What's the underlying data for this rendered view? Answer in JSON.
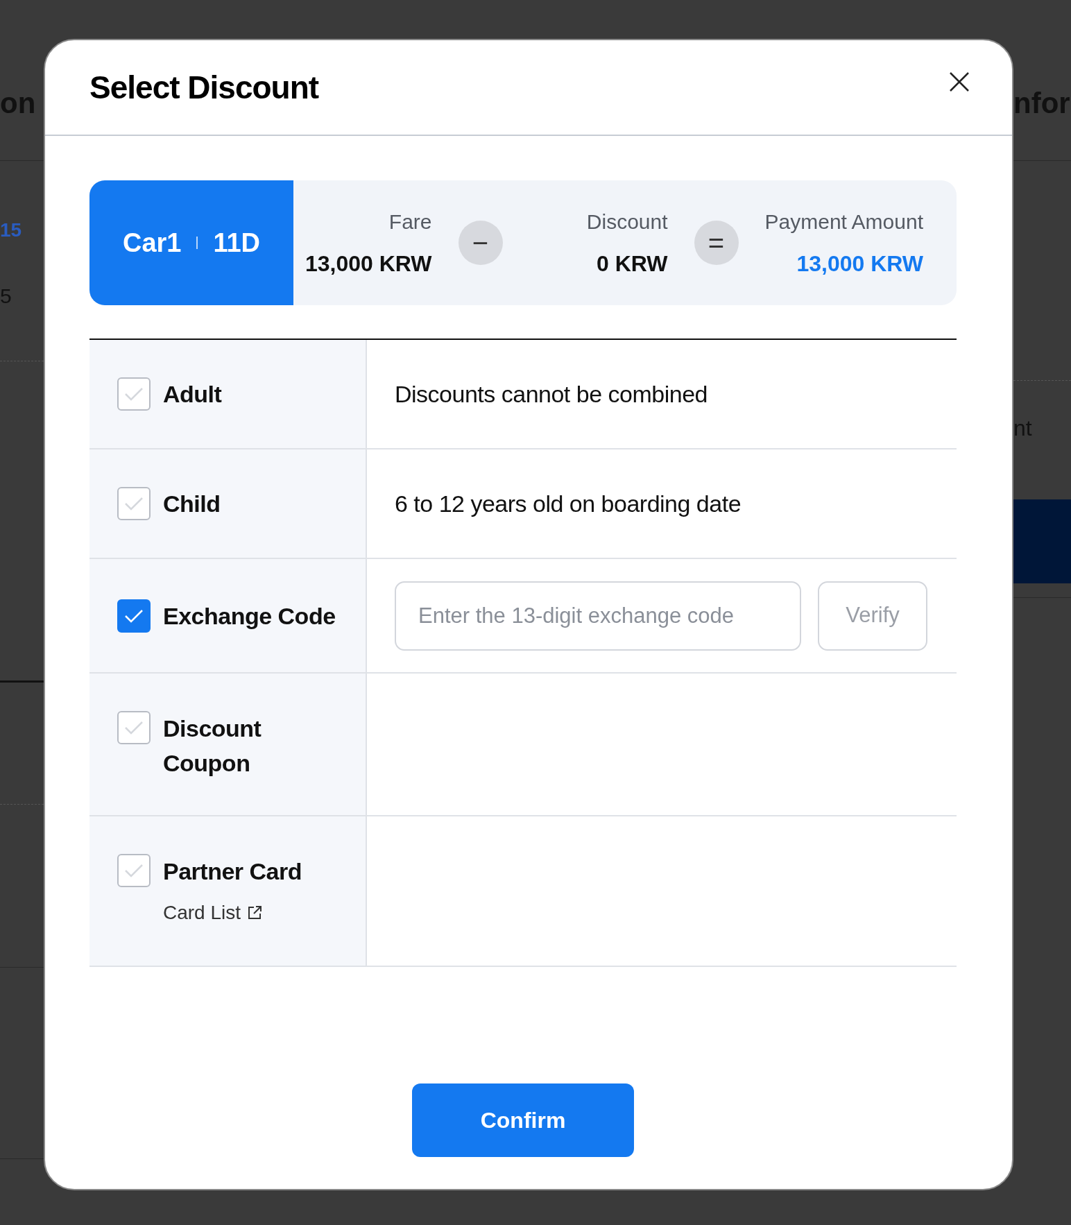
{
  "background": {
    "left_texts": [
      "on",
      "15",
      "5"
    ],
    "right_texts": [
      "nfor",
      "nt"
    ]
  },
  "dialog": {
    "title": "Select Discount",
    "summary": {
      "car": "Car1",
      "seat": "11D",
      "fare_label": "Fare",
      "fare": "13,000 KRW",
      "minus": "−",
      "discount_label": "Discount",
      "discount": "0 KRW",
      "equals": "=",
      "payment_label": "Payment Amount",
      "payment": "13,000 KRW"
    },
    "options": [
      {
        "kind": "text",
        "label": "Adult",
        "checked": false,
        "detail": "Discounts cannot be combined"
      },
      {
        "kind": "text",
        "label": "Child",
        "checked": false,
        "detail": "6 to 12 years old on boarding date"
      },
      {
        "kind": "code",
        "label": "Exchange Code",
        "checked": true,
        "placeholder": "Enter the 13-digit exchange code",
        "button": "Verify"
      },
      {
        "kind": "empty",
        "label": "Discount Coupon",
        "checked": false
      },
      {
        "kind": "link",
        "label": "Partner Card",
        "checked": false,
        "link": "Card List"
      }
    ],
    "confirm": "Confirm"
  }
}
